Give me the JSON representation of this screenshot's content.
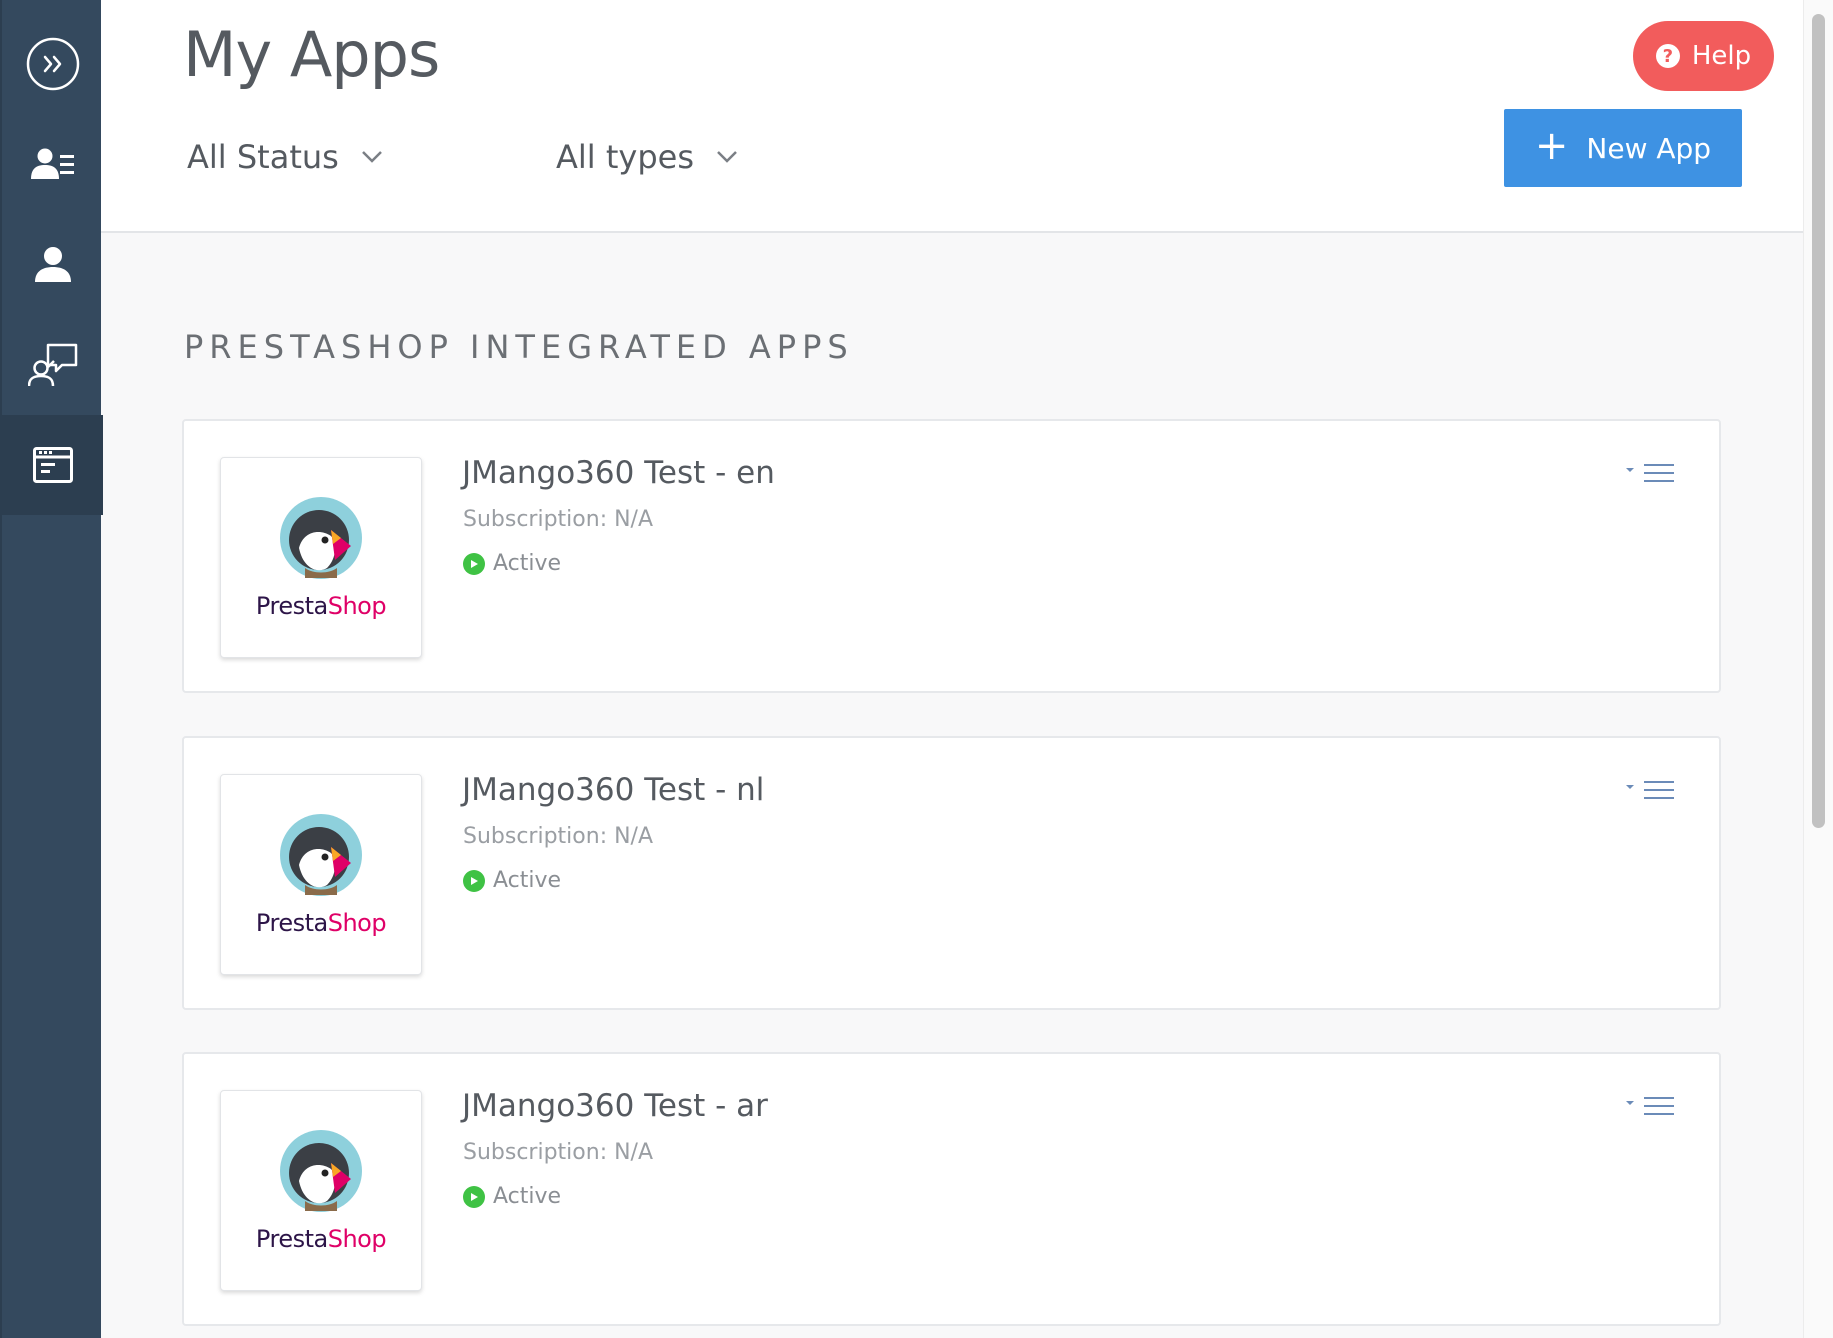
{
  "page": {
    "title": "My Apps"
  },
  "filters": {
    "status": "All Status",
    "types": "All types"
  },
  "header": {
    "help_label": "Help",
    "new_app_label": "New App"
  },
  "sidebar": {
    "items": [
      {
        "icon": "expand-icon"
      },
      {
        "icon": "contacts-list-icon"
      },
      {
        "icon": "user-icon"
      },
      {
        "icon": "support-chat-icon"
      },
      {
        "icon": "app-window-icon",
        "active": true
      }
    ]
  },
  "section": {
    "title": "PRESTASHOP INTEGRATED APPS"
  },
  "apps": [
    {
      "name": "JMango360 Test - en",
      "subscription": "Subscription: N/A",
      "status": "Active",
      "logo_text": "PrestaShop"
    },
    {
      "name": "JMango360 Test - nl",
      "subscription": "Subscription: N/A",
      "status": "Active",
      "logo_text": "PrestaShop"
    },
    {
      "name": "JMango360 Test - ar",
      "subscription": "Subscription: N/A",
      "status": "Active",
      "logo_text": "PrestaShop"
    }
  ],
  "colors": {
    "sidebar": "#34495e",
    "sidebar_active": "#2c3e50",
    "help": "#f25c5c",
    "primary": "#3e92e3",
    "status_active": "#3fc244",
    "prestashop_dark": "#2d1548",
    "prestashop_pink": "#df0067"
  }
}
